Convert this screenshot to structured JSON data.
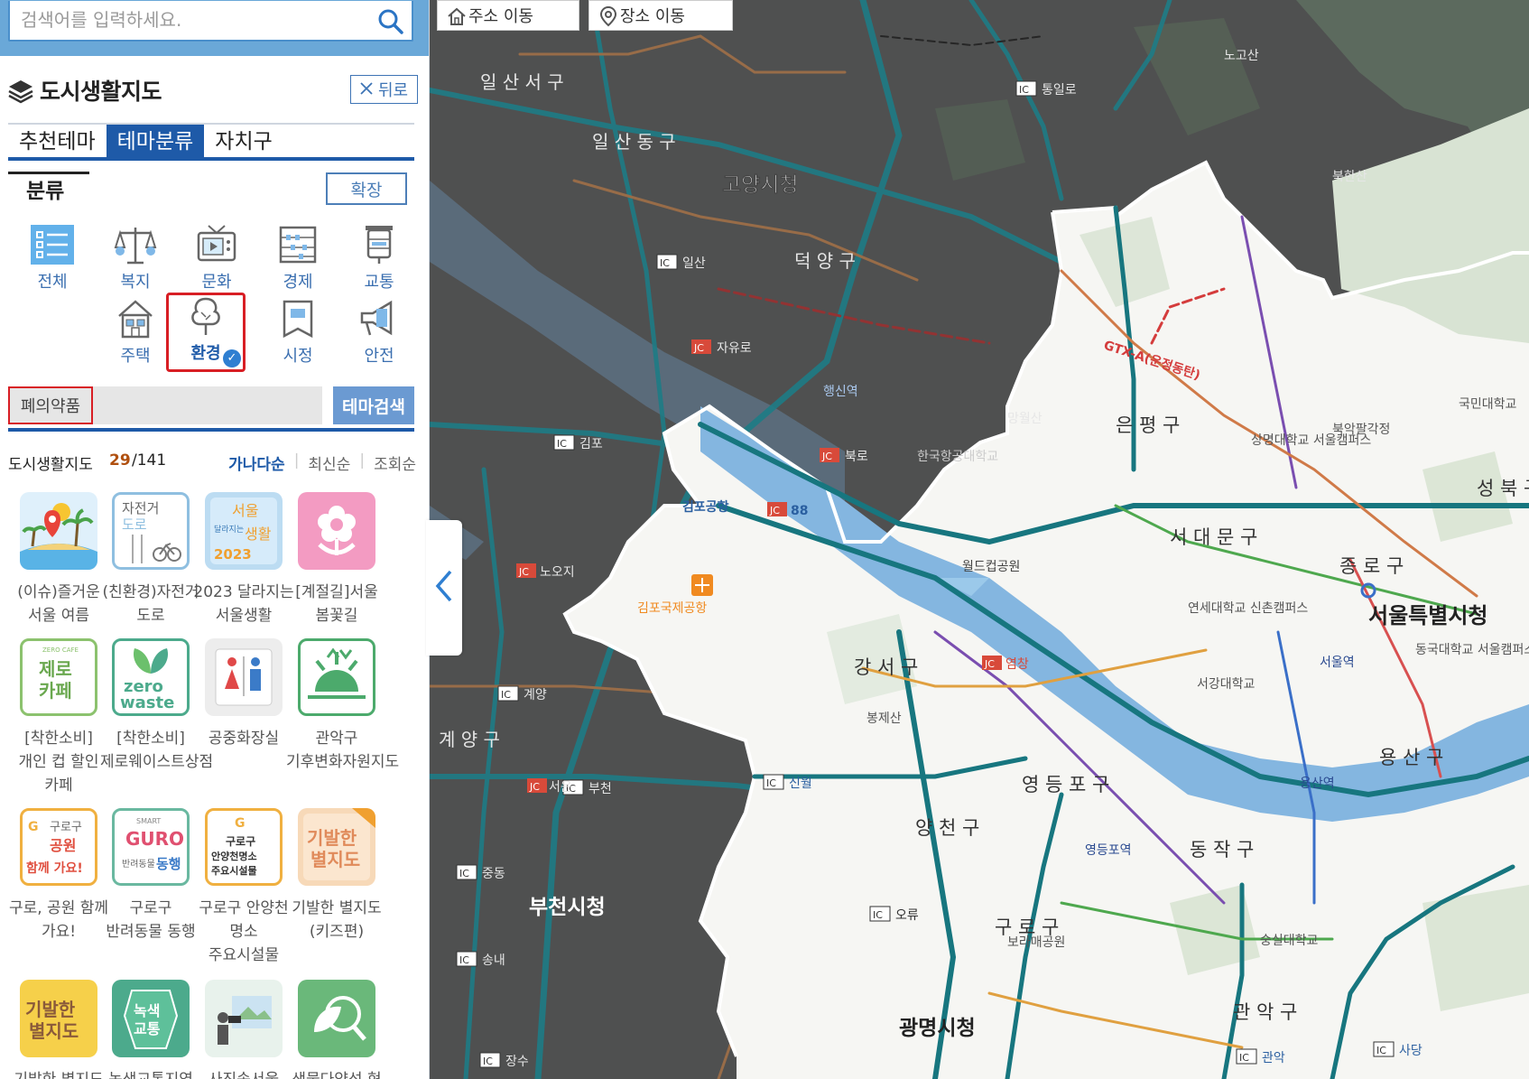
{
  "search": {
    "placeholder": "검색어를 입력하세요."
  },
  "panel": {
    "title": "도시생활지도",
    "back_label": "뒤로",
    "tabs": [
      {
        "label": "추천테마",
        "active": false
      },
      {
        "label": "테마분류",
        "active": true
      },
      {
        "label": "자치구",
        "active": false
      }
    ],
    "category_label": "분류",
    "expand_label": "확장",
    "categories": [
      {
        "label": "전체",
        "icon": "list-icon"
      },
      {
        "label": "복지",
        "icon": "scale-icon"
      },
      {
        "label": "문화",
        "icon": "tv-icon"
      },
      {
        "label": "경제",
        "icon": "abacus-icon"
      },
      {
        "label": "교통",
        "icon": "traffic-light-icon"
      },
      {
        "label": "주택",
        "icon": "house-icon"
      },
      {
        "label": "환경",
        "icon": "tree-icon",
        "selected": true
      },
      {
        "label": "시정",
        "icon": "document-icon"
      },
      {
        "label": "안전",
        "icon": "megaphone-icon"
      }
    ],
    "theme_tag": "폐의약품",
    "theme_search_label": "테마검색",
    "list_title": "도시생활지도",
    "list_count": "29",
    "list_total": "/141",
    "sort": [
      {
        "label": "가나다순",
        "active": true
      },
      {
        "label": "최신순",
        "active": false
      },
      {
        "label": "조회순",
        "active": false
      }
    ],
    "maps": [
      {
        "label": "(이슈)즐거운 서울 여름",
        "thumb": "summer-island"
      },
      {
        "label": "(친환경)자전거 도로",
        "thumb": "bike-road"
      },
      {
        "label": "2023 달라지는 서울생활",
        "thumb": "seoul-2023"
      },
      {
        "label": "[계절길]서울 봄꽃길",
        "thumb": "flower"
      },
      {
        "label": "[착한소비] 개인 컵 할인 카페",
        "thumb": "zero-cafe"
      },
      {
        "label": "[착한소비]제로웨이스트상점",
        "thumb": "zero-waste"
      },
      {
        "label": "공중화장실",
        "thumb": "restroom"
      },
      {
        "label": "관악구 기후변화자원지도",
        "thumb": "sunrise"
      },
      {
        "label": "구로, 공원 함께 가요!",
        "thumb": "guro-park"
      },
      {
        "label": "구로구 반려동물 동행",
        "thumb": "guro-pet"
      },
      {
        "label": "구로구 안양천 명소 주요시설물",
        "thumb": "guro-anyang"
      },
      {
        "label": "기발한 별지도 (키즈편)",
        "thumb": "star-map-kids"
      },
      {
        "label": "기발한 별지도",
        "thumb": "star-map"
      },
      {
        "label": "녹색교통지역",
        "thumb": "green-traffic"
      },
      {
        "label": "사진속서울",
        "thumb": "photo-seoul"
      },
      {
        "label": "생물다양성 현",
        "thumb": "biodiversity"
      }
    ]
  },
  "map": {
    "buttons": [
      {
        "label": "주소 이동",
        "icon": "home-icon"
      },
      {
        "label": "장소 이동",
        "icon": "pin-icon"
      }
    ],
    "labels": {
      "seoul_city_hall": "서울특별시청",
      "goyang_city_hall": "고양시청",
      "bucheon_city_hall": "부천시청",
      "gwangmyeong_city_hall": "광명시청",
      "ilsanseo": "일 산 서 구",
      "ilsandong": "일 산 동 구",
      "deogyang": "덕 양 구",
      "eunpyeong": "은 평 구",
      "seodaemun": "서 대 문 구",
      "jongno": "종 로 구",
      "seongbuk": "성 북 구",
      "gangseo": "강 서 구",
      "yangcheon": "양 천 구",
      "yeongdeungpo": "영 등 포 구",
      "yongsan": "용 산 구",
      "dongjak": "동 작 구",
      "guro": "구 로 구",
      "gwanak": "관 악 구",
      "gyeyang": "계 양 구",
      "gimpo_airport": "김포공항",
      "gimpo_intl": "김포국제공항",
      "world_cup_park": "월드컵공원",
      "bongjesan": "봉제산",
      "yeonsei": "연세대학교 신촌캠퍼스",
      "sogang": "서강대학교",
      "ktx_seoul": "서울역",
      "ktx_yongsan": "용산역",
      "ktx_yeongdeungpo": "영등포역",
      "ktx_haengsin": "행신역",
      "ic_ilsan": "일산",
      "ic_gimpo": "김포",
      "ic_sinwol": "신월",
      "ic_bucheon": "부천",
      "ic_jungdong": "중동",
      "ic_songnae": "송내",
      "ic_jangsu": "장수",
      "ic_oryu": "오류",
      "ic_gyeyang": "계양",
      "ic_gwanak": "관악",
      "ic_sadang": "사당",
      "ic_tongil": "통일로",
      "jc_jayuro": "자유로",
      "jc_bukro": "북로",
      "jc_88": "88",
      "jc_seoun": "서운",
      "jc_nodu": "노오지",
      "jc_yeomchang": "염창",
      "gtx": "GTX-A(운정동탄)",
      "north_mountain": "북한산",
      "bugak": "북악팔각정",
      "kookmin": "국민대학교",
      "sangmyung": "상명대학교 서울캠퍼스",
      "dongguk": "동국대학교 서울캠퍼스",
      "boramae": "보라매공원",
      "soongsil": "숭실대학교",
      "mangwolsan": "망월산",
      "nogosan": "노고산",
      "hankuk_aero": "한국항공대학교"
    }
  },
  "colors": {
    "accent": "#1e5aa8",
    "highlight": "#d81e24",
    "count": "#b05010",
    "search_bar": "#6aa8d8",
    "water": "#84b6e0",
    "dim_map": "#4d4d4d",
    "seoul_land": "#f7f7f5"
  }
}
